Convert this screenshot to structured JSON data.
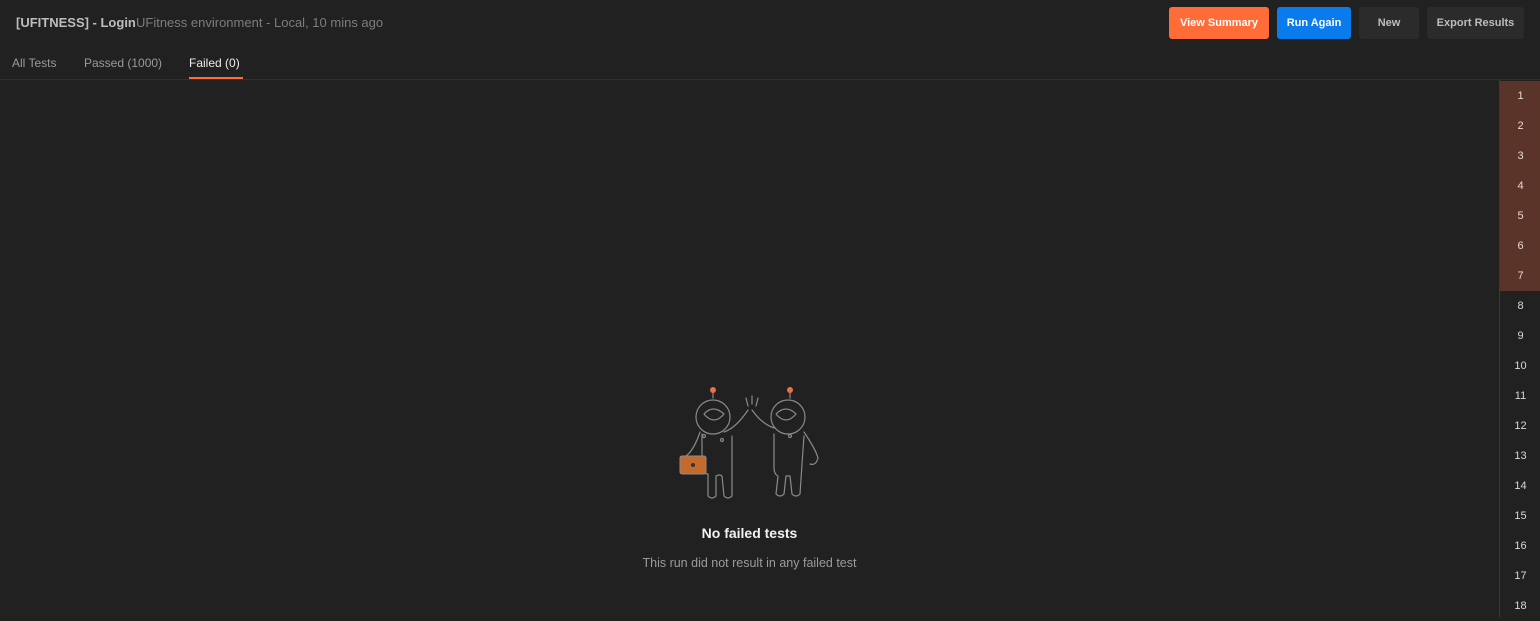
{
  "header": {
    "title": "[UFITNESS] - Login",
    "subtitle": "UFitness environment - Local, 10 mins ago",
    "buttons": {
      "view_summary": "View Summary",
      "run_again": "Run Again",
      "new": "New",
      "export_results": "Export Results"
    }
  },
  "tabs": {
    "all": "All Tests",
    "passed": "Passed (1000)",
    "failed": "Failed (0)",
    "active": "Failed (0)"
  },
  "empty_state": {
    "illustration": "astronauts-high-five-icon",
    "title": "No failed tests",
    "description": "This run did not result in any failed test"
  },
  "iterations": {
    "items": [
      "1",
      "2",
      "3",
      "4",
      "5",
      "6",
      "7",
      "8",
      "9",
      "10",
      "11",
      "12",
      "13",
      "14",
      "15",
      "16",
      "17",
      "18"
    ],
    "highlighted": [
      "1",
      "2",
      "3",
      "4",
      "5",
      "6",
      "7"
    ]
  },
  "colors": {
    "accent": "#ff6c37",
    "primary": "#097bed",
    "background": "#212121",
    "iteration_highlight": "#5a3428"
  }
}
